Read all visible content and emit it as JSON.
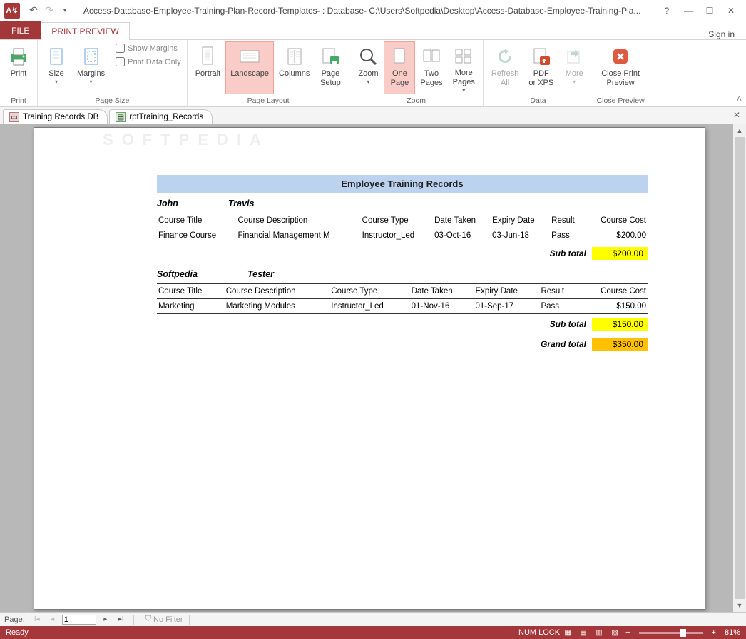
{
  "titlebar": {
    "title_text": "Access-Database-Employee-Training-Plan-Record-Templates- : Database- C:\\Users\\Softpedia\\Desktop\\Access-Database-Employee-Training-Pla...",
    "app_abbrev": "A↯"
  },
  "tabs": {
    "file": "FILE",
    "print_preview": "PRINT PREVIEW",
    "sign_in": "Sign in"
  },
  "ribbon": {
    "print": {
      "label": "Print",
      "group": "Print"
    },
    "size": "Size",
    "margins": "Margins",
    "show_margins": "Show Margins",
    "print_data_only": "Print Data Only",
    "page_size_group": "Page Size",
    "portrait": "Portrait",
    "landscape": "Landscape",
    "columns": "Columns",
    "page_setup": "Page\nSetup",
    "page_layout_group": "Page Layout",
    "zoom": "Zoom",
    "one_page": "One\nPage",
    "two_pages": "Two\nPages",
    "more_pages": "More\nPages",
    "zoom_group": "Zoom",
    "refresh_all": "Refresh\nAll",
    "pdf_xps": "PDF\nor XPS",
    "more": "More",
    "data_group": "Data",
    "close_preview": "Close Print\nPreview",
    "close_group": "Close Preview"
  },
  "doctabs": {
    "tab1": "Training Records DB",
    "tab2": "rptTraining_Records"
  },
  "report": {
    "title": "Employee Training Records",
    "headers": {
      "course_title": "Course Title",
      "course_desc": "Course Description",
      "course_type": "Course Type",
      "date_taken": "Date Taken",
      "expiry_date": "Expiry Date",
      "result": "Result",
      "course_cost": "Course Cost"
    },
    "employees": [
      {
        "first": "John",
        "last": "Travis",
        "rows": [
          {
            "title": "Finance Course",
            "desc": "Financial Management M",
            "type": "Instructor_Led",
            "taken": "03-Oct-16",
            "expiry": "03-Jun-18",
            "result": "Pass",
            "cost": "$200.00"
          }
        ],
        "subtotal": "$200.00"
      },
      {
        "first": "Softpedia",
        "last": "Tester",
        "rows": [
          {
            "title": "Marketing",
            "desc": "Marketing Modules",
            "type": "Instructor_Led",
            "taken": "01-Nov-16",
            "expiry": "01-Sep-17",
            "result": "Pass",
            "cost": "$150.00"
          }
        ],
        "subtotal": "$150.00"
      }
    ],
    "subtotal_label": "Sub total",
    "grandtotal_label": "Grand total",
    "grandtotal": "$350.00",
    "watermark": "SOFTPEDIA"
  },
  "navbar": {
    "label": "Page:",
    "current": "1",
    "filter": "No Filter"
  },
  "status": {
    "ready": "Ready",
    "numlock": "NUM LOCK",
    "zoom": "81%"
  }
}
